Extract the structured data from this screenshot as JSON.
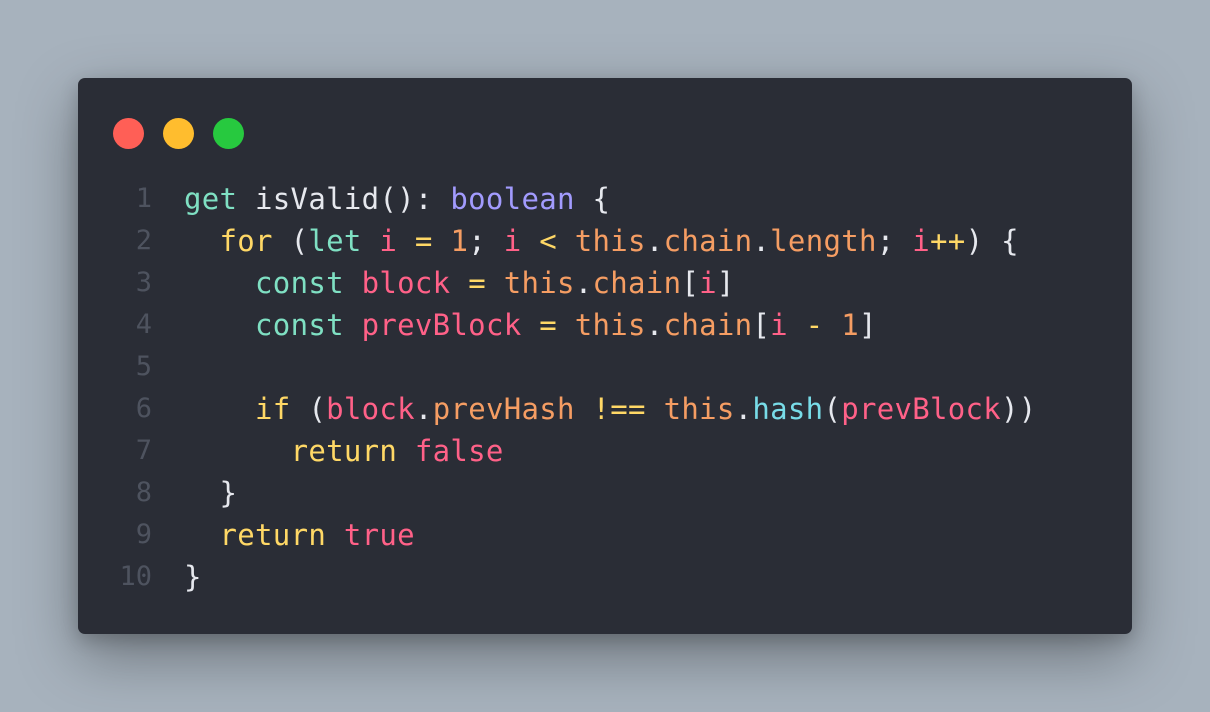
{
  "colors": {
    "background": "#a7b2bd",
    "window": "#2a2d36",
    "line_number": "#4e535f",
    "close": "#ff5f56",
    "minimize": "#ffbd2e",
    "zoom": "#27c93f",
    "plain": "#e6e8ee",
    "keyword_green": "#7fe0c3",
    "keyword_yellow": "#ffd866",
    "type_purple": "#a29bfe",
    "identifier_pink": "#ff6188",
    "member_orange": "#f59d63",
    "method_cyan": "#78dce8"
  },
  "traffic_lights": [
    {
      "name": "close",
      "color": "#ff5f56"
    },
    {
      "name": "minimize",
      "color": "#ffbd2e"
    },
    {
      "name": "zoom",
      "color": "#27c93f"
    }
  ],
  "code_lines": [
    {
      "number": "1",
      "tokens": [
        {
          "text": "get",
          "color": "#7fe0c3"
        },
        {
          "text": " isValid(): ",
          "color": "#e6e8ee"
        },
        {
          "text": "boolean",
          "color": "#a29bfe"
        },
        {
          "text": " {",
          "color": "#e6e8ee"
        }
      ]
    },
    {
      "number": "2",
      "tokens": [
        {
          "text": "  ",
          "color": "#e6e8ee"
        },
        {
          "text": "for",
          "color": "#ffd866"
        },
        {
          "text": " (",
          "color": "#e6e8ee"
        },
        {
          "text": "let",
          "color": "#7fe0c3"
        },
        {
          "text": " ",
          "color": "#e6e8ee"
        },
        {
          "text": "i",
          "color": "#ff6188"
        },
        {
          "text": " = ",
          "color": "#ffd866"
        },
        {
          "text": "1",
          "color": "#f59d63"
        },
        {
          "text": "; ",
          "color": "#e6e8ee"
        },
        {
          "text": "i",
          "color": "#ff6188"
        },
        {
          "text": " < ",
          "color": "#ffd866"
        },
        {
          "text": "this",
          "color": "#f59d63"
        },
        {
          "text": ".",
          "color": "#e6e8ee"
        },
        {
          "text": "chain",
          "color": "#f59d63"
        },
        {
          "text": ".",
          "color": "#e6e8ee"
        },
        {
          "text": "length",
          "color": "#f59d63"
        },
        {
          "text": "; ",
          "color": "#e6e8ee"
        },
        {
          "text": "i",
          "color": "#ff6188"
        },
        {
          "text": "++",
          "color": "#ffd866"
        },
        {
          "text": ") {",
          "color": "#e6e8ee"
        }
      ]
    },
    {
      "number": "3",
      "tokens": [
        {
          "text": "    ",
          "color": "#e6e8ee"
        },
        {
          "text": "const",
          "color": "#7fe0c3"
        },
        {
          "text": " ",
          "color": "#e6e8ee"
        },
        {
          "text": "block",
          "color": "#ff6188"
        },
        {
          "text": " = ",
          "color": "#ffd866"
        },
        {
          "text": "this",
          "color": "#f59d63"
        },
        {
          "text": ".",
          "color": "#e6e8ee"
        },
        {
          "text": "chain",
          "color": "#f59d63"
        },
        {
          "text": "[",
          "color": "#e6e8ee"
        },
        {
          "text": "i",
          "color": "#ff6188"
        },
        {
          "text": "]",
          "color": "#e6e8ee"
        }
      ]
    },
    {
      "number": "4",
      "tokens": [
        {
          "text": "    ",
          "color": "#e6e8ee"
        },
        {
          "text": "const",
          "color": "#7fe0c3"
        },
        {
          "text": " ",
          "color": "#e6e8ee"
        },
        {
          "text": "prevBlock",
          "color": "#ff6188"
        },
        {
          "text": " = ",
          "color": "#ffd866"
        },
        {
          "text": "this",
          "color": "#f59d63"
        },
        {
          "text": ".",
          "color": "#e6e8ee"
        },
        {
          "text": "chain",
          "color": "#f59d63"
        },
        {
          "text": "[",
          "color": "#e6e8ee"
        },
        {
          "text": "i",
          "color": "#ff6188"
        },
        {
          "text": " - ",
          "color": "#ffd866"
        },
        {
          "text": "1",
          "color": "#f59d63"
        },
        {
          "text": "]",
          "color": "#e6e8ee"
        }
      ]
    },
    {
      "number": "5",
      "tokens": []
    },
    {
      "number": "6",
      "tokens": [
        {
          "text": "    ",
          "color": "#e6e8ee"
        },
        {
          "text": "if",
          "color": "#ffd866"
        },
        {
          "text": " (",
          "color": "#e6e8ee"
        },
        {
          "text": "block",
          "color": "#ff6188"
        },
        {
          "text": ".",
          "color": "#e6e8ee"
        },
        {
          "text": "prevHash",
          "color": "#f59d63"
        },
        {
          "text": " !== ",
          "color": "#ffd866"
        },
        {
          "text": "this",
          "color": "#f59d63"
        },
        {
          "text": ".",
          "color": "#e6e8ee"
        },
        {
          "text": "hash",
          "color": "#78dce8"
        },
        {
          "text": "(",
          "color": "#e6e8ee"
        },
        {
          "text": "prevBlock",
          "color": "#ff6188"
        },
        {
          "text": "))",
          "color": "#e6e8ee"
        }
      ]
    },
    {
      "number": "7",
      "tokens": [
        {
          "text": "      ",
          "color": "#e6e8ee"
        },
        {
          "text": "return",
          "color": "#ffd866"
        },
        {
          "text": " ",
          "color": "#e6e8ee"
        },
        {
          "text": "false",
          "color": "#ff6188"
        }
      ]
    },
    {
      "number": "8",
      "tokens": [
        {
          "text": "  }",
          "color": "#e6e8ee"
        }
      ]
    },
    {
      "number": "9",
      "tokens": [
        {
          "text": "  ",
          "color": "#e6e8ee"
        },
        {
          "text": "return",
          "color": "#ffd866"
        },
        {
          "text": " ",
          "color": "#e6e8ee"
        },
        {
          "text": "true",
          "color": "#ff6188"
        }
      ]
    },
    {
      "number": "10",
      "tokens": [
        {
          "text": "}",
          "color": "#e6e8ee"
        }
      ]
    }
  ]
}
